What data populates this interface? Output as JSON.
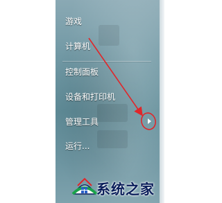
{
  "start_menu": {
    "items": [
      {
        "label": "游戏"
      },
      {
        "label": "计算机"
      },
      {
        "label": "控制面板"
      },
      {
        "label": "设备和打印机"
      },
      {
        "label": "管理工具"
      },
      {
        "label": "运行..."
      }
    ],
    "submenu_arrow_icon": "triangle-right-icon"
  },
  "annotation": {
    "arrow_color": "#e0262a",
    "circle_color": "#e0262a"
  },
  "watermark": {
    "brand_text": "系统之家",
    "brand_color": "#0a1e5a"
  }
}
